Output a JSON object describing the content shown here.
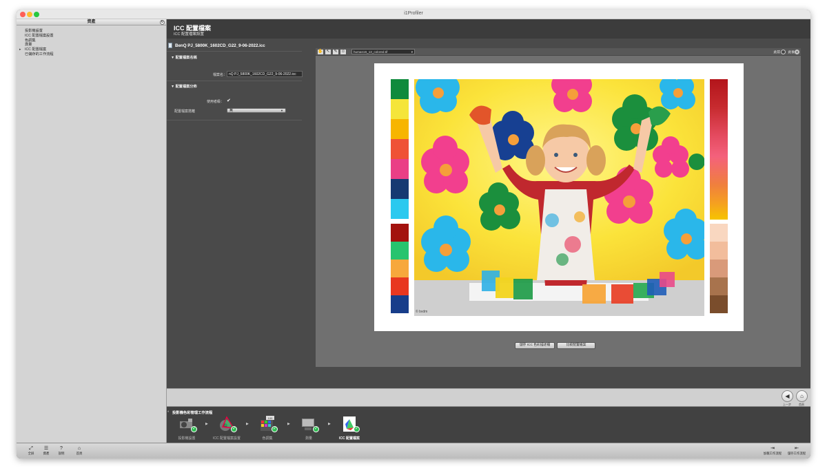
{
  "window": {
    "title": "i1Profiler"
  },
  "left_panel": {
    "header": "資產",
    "items": [
      {
        "label": "投影機設置",
        "active": false
      },
      {
        "label": "ICC 配置檔案設置",
        "active": false
      },
      {
        "label": "色調集",
        "active": false
      },
      {
        "label": "測量",
        "active": false
      },
      {
        "label": "ICC 配置檔案",
        "active": true
      },
      {
        "label": "已儲存的工作流程",
        "active": false
      }
    ]
  },
  "header": {
    "title": "ICC 配置檔案",
    "subtitle": "ICC 配置檔案設置"
  },
  "settings": {
    "file_title": "BenQ PJ_5800K_1602CD_G22_9-06-2022.icc",
    "section_name": {
      "title": "配置檔案名稱",
      "field_label": "檔案名：",
      "field_value": "nQ PJ_5800K_1602CD_G22_9-06-2022.icc"
    },
    "section_distribution": {
      "title": "配置檔案分佈",
      "admin_label": "使用者級：",
      "admin_checked": "✔",
      "select_label": "配置檔案搭離",
      "select_value": "無"
    }
  },
  "preview": {
    "image_select": "human16_13_colored.tif",
    "before_label": "此前",
    "after_label": "此後",
    "photo_credit": "© bvdm",
    "left_swatches": [
      "#0f8a3c",
      "#f5e53a",
      "#f7b500",
      "#ef5236",
      "#ea3f86",
      "#163a72",
      "#2bc9ef",
      "#a3120e",
      "#27c46e",
      "#f7a83c",
      "#e8371f",
      "#173d8a"
    ],
    "right_swatches": [
      "#b3151b",
      "#c72b2f",
      "#e44a5f",
      "#f4617c",
      "#f07f3e",
      "#f59f21",
      "#f6c400",
      "#f9d7c0",
      "#f2bd9c",
      "#d99a7a",
      "#a8734d",
      "#7a4d2c",
      "#503323"
    ],
    "save_button": "儲存 ICC 色彩描述檔",
    "compare_button": "比較配置檔案"
  },
  "nav": {
    "prev_label": "上一步",
    "home_label": "首頁"
  },
  "workflow": {
    "title": "投影機色彩管理工作流程",
    "steps": [
      {
        "label": "投影機設置"
      },
      {
        "label": "ICC 配置檔案設置"
      },
      {
        "label": "色調集",
        "badge": "100"
      },
      {
        "label": "測量"
      },
      {
        "label": "ICC 配置檔案"
      }
    ]
  },
  "bottom_bar": {
    "fullscreen": "全屏",
    "assets": "資產",
    "help": "說明",
    "home": "首頁",
    "add_workflow": "加載工作流程",
    "save_workflow": "儲存工作流程"
  },
  "colors": {
    "ok_green": "#2fbd52",
    "panel_dark": "#4a4a4a"
  }
}
